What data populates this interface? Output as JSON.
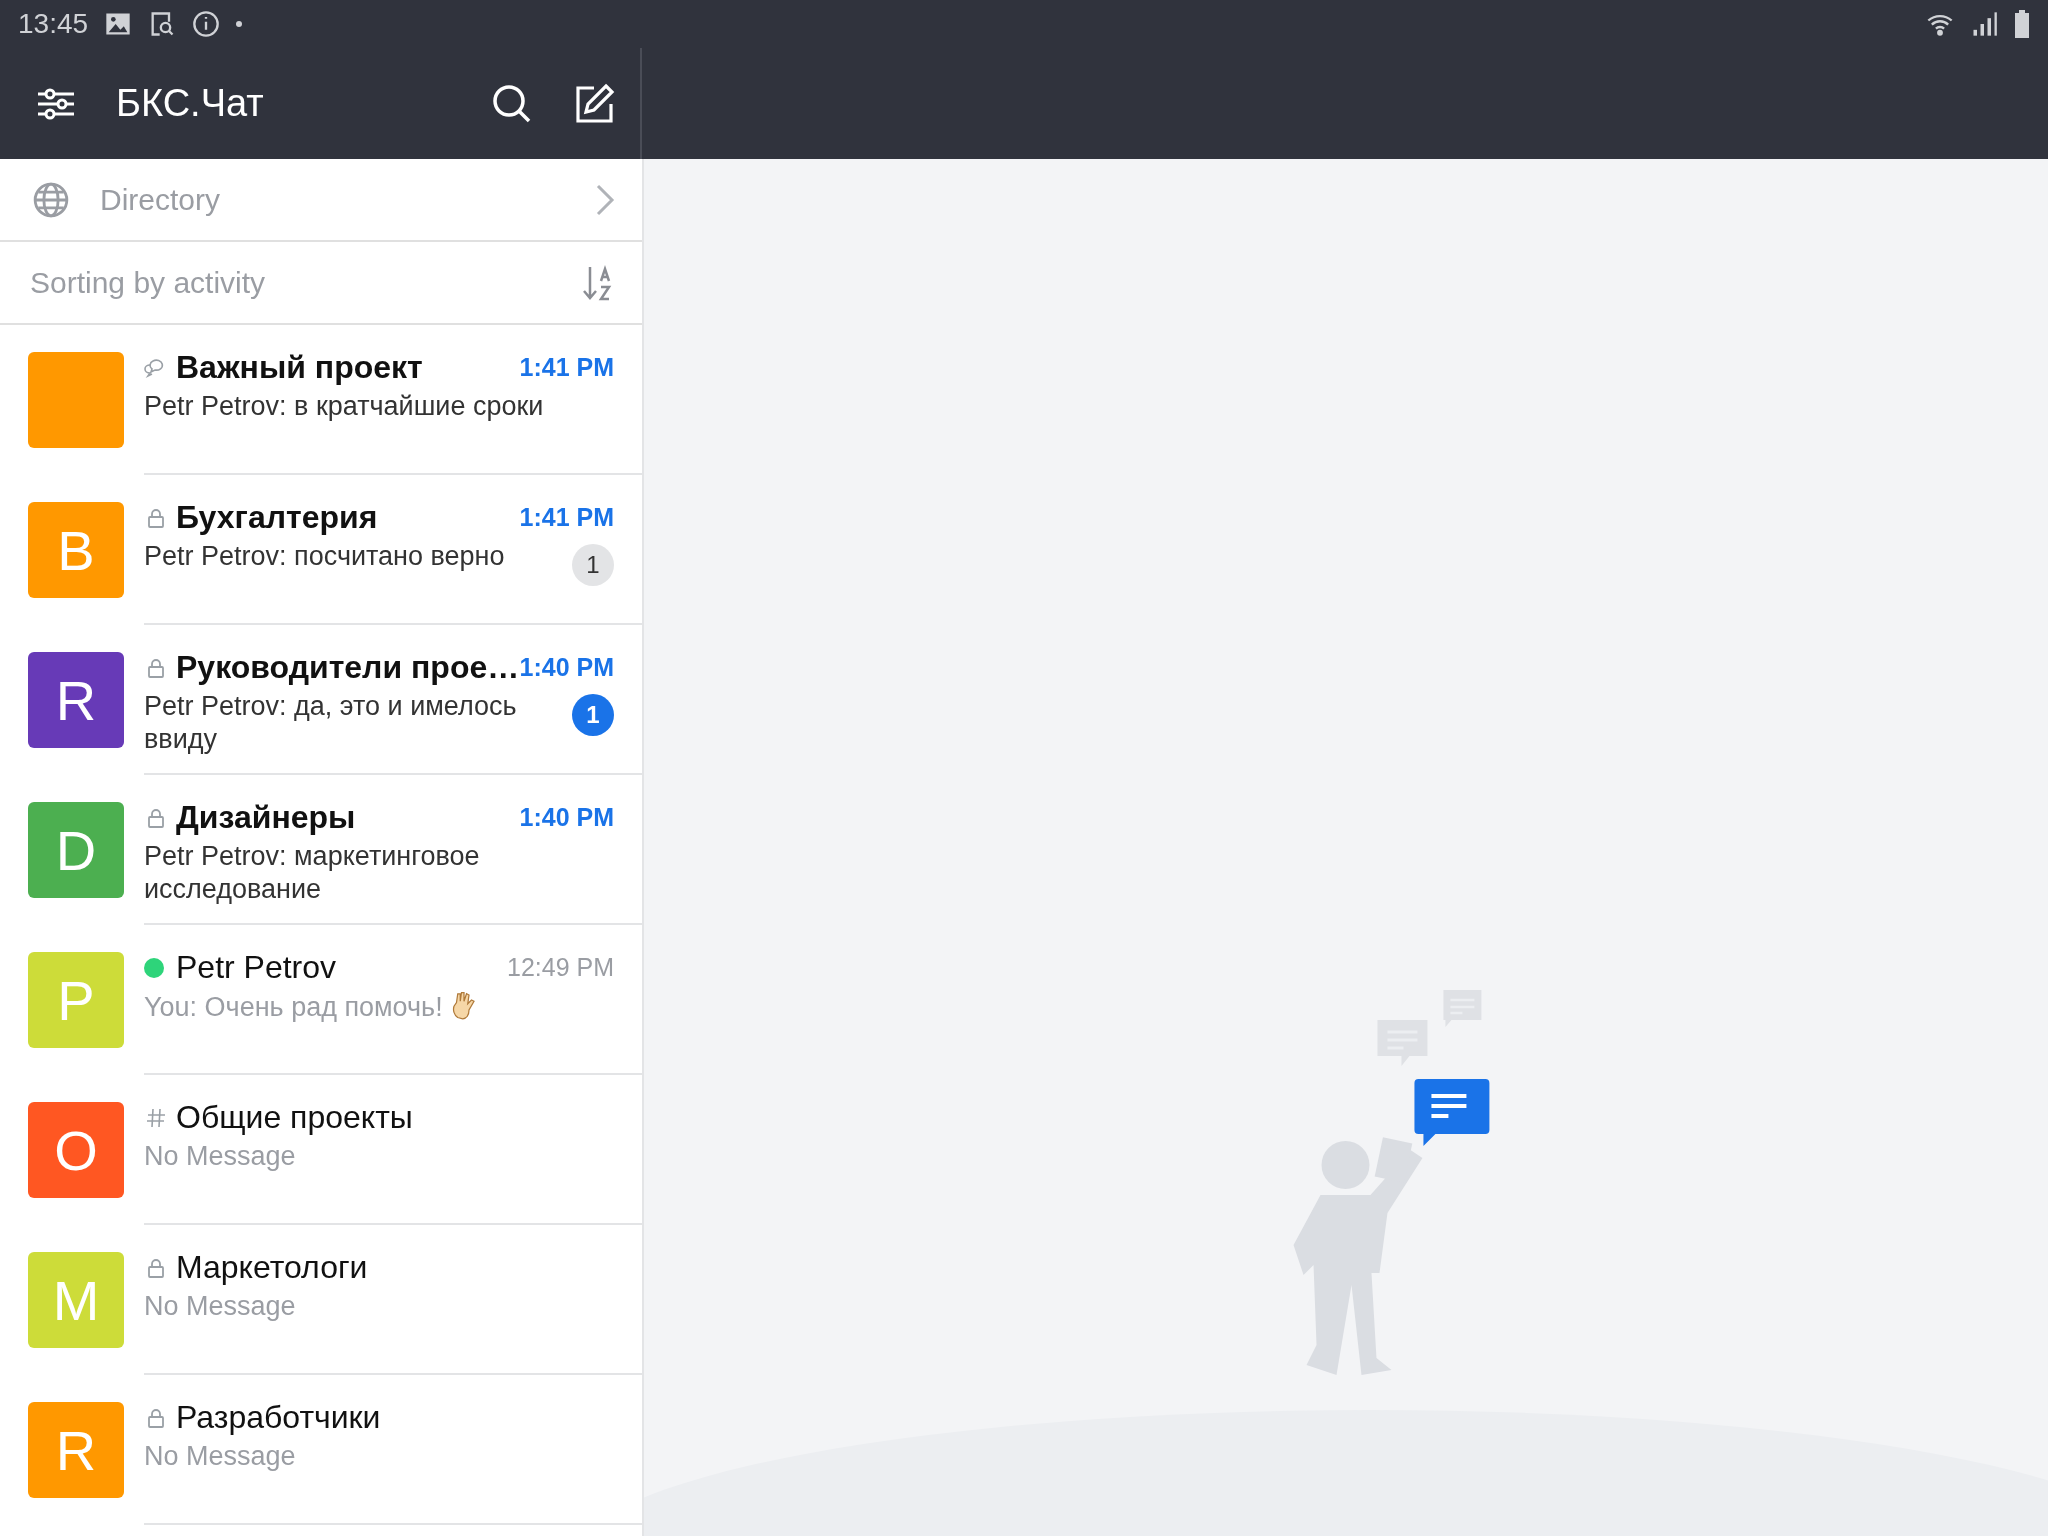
{
  "status_bar": {
    "time": "13:45"
  },
  "header": {
    "title": "БКС.Чат"
  },
  "directory": {
    "label": "Directory"
  },
  "sorting": {
    "label": "Sorting by activity"
  },
  "chats": [
    {
      "kind": "discussion",
      "color": "#ff9800",
      "title": "Важный проект",
      "time": "1:41 PM",
      "preview": "Petr Petrov: в кратчайшие сроки",
      "unread": true
    },
    {
      "kind": "private",
      "avatar": "B",
      "color": "#ff9800",
      "title": "Бухгалтерия",
      "time": "1:41 PM",
      "preview": "Petr Petrov: посчитано верно",
      "unread": true,
      "badge": {
        "count": "1",
        "muted": true
      }
    },
    {
      "kind": "private",
      "avatar": "R",
      "color": "#673ab7",
      "title": "Руководители прое…",
      "time": "1:40 PM",
      "preview": "Petr Petrov: да, это и имелось ввиду",
      "unread": true,
      "badge": {
        "count": "1",
        "muted": false
      }
    },
    {
      "kind": "private",
      "avatar": "D",
      "color": "#4caf50",
      "title": "Дизайнеры",
      "time": "1:40 PM",
      "preview": "Petr Petrov: маркетинговое исследование",
      "unread": true
    },
    {
      "kind": "online",
      "avatar": "P",
      "color": "#cddc39",
      "title": "Petr Petrov",
      "time": "12:49 PM",
      "preview": "You: Очень рад помочь!",
      "unread": false,
      "emoji": true
    },
    {
      "kind": "channel",
      "avatar": "O",
      "color": "#ff5722",
      "title": "Общие проекты",
      "preview": "No Message",
      "unread": false
    },
    {
      "kind": "private",
      "avatar": "M",
      "color": "#cddc39",
      "title": "Маркетологи",
      "preview": "No Message",
      "unread": false
    },
    {
      "kind": "private",
      "avatar": "R",
      "color": "#ff9800",
      "title": "Разработчики",
      "preview": "No Message",
      "unread": false
    }
  ]
}
